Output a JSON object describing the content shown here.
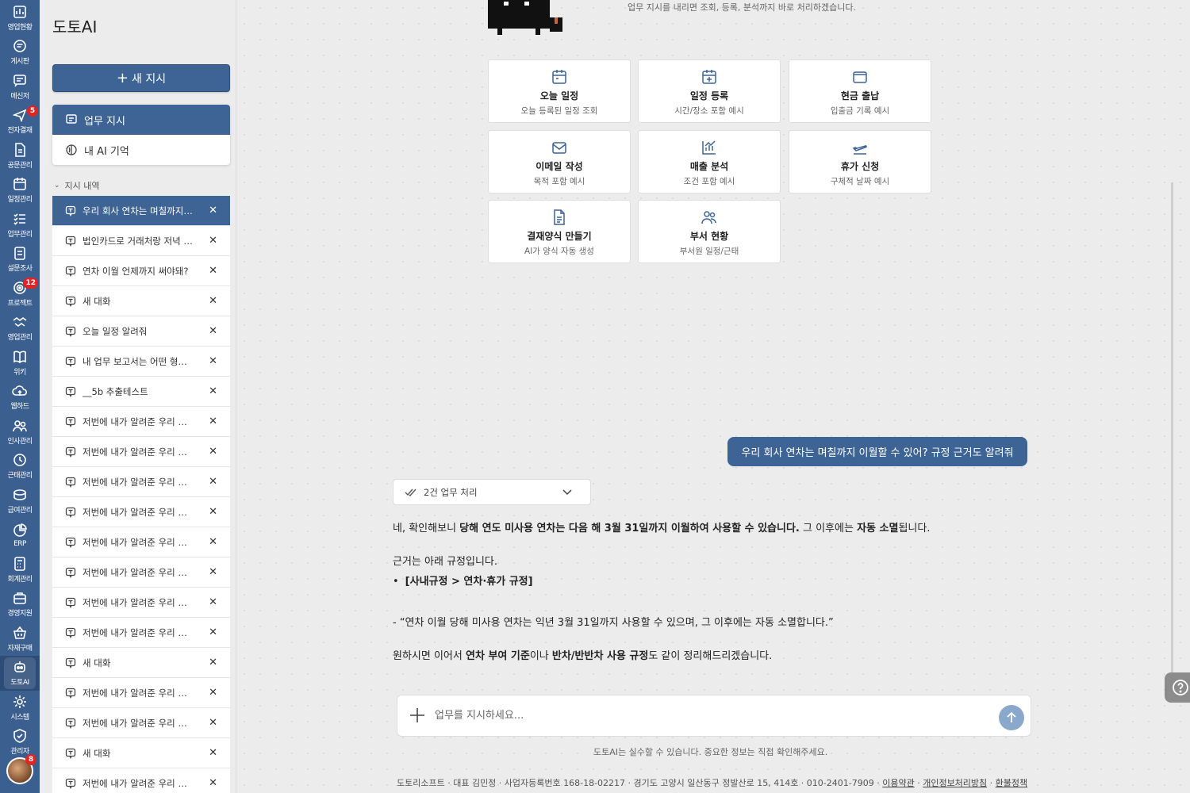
{
  "rail": {
    "items": [
      {
        "label": "영업현황",
        "icon": "dashboard-icon"
      },
      {
        "label": "게시판",
        "icon": "board-icon"
      },
      {
        "label": "메신저",
        "icon": "messenger-icon"
      },
      {
        "label": "전자결재",
        "icon": "approval-icon",
        "badge": "5"
      },
      {
        "label": "공문관리",
        "icon": "document-icon"
      },
      {
        "label": "일정관리",
        "icon": "calendar-icon"
      },
      {
        "label": "업무관리",
        "icon": "tasks-icon"
      },
      {
        "label": "설문조사",
        "icon": "survey-icon"
      },
      {
        "label": "프로젝트",
        "icon": "target-icon",
        "badge": "12"
      },
      {
        "label": "영업관리",
        "icon": "handshake-icon"
      },
      {
        "label": "위키",
        "icon": "book-icon"
      },
      {
        "label": "웹하드",
        "icon": "cloud-icon"
      },
      {
        "label": "인사관리",
        "icon": "people-icon"
      },
      {
        "label": "근태관리",
        "icon": "clock-icon"
      },
      {
        "label": "급여관리",
        "icon": "coins-icon"
      },
      {
        "label": "ERP",
        "icon": "pie-chart-icon"
      },
      {
        "label": "회계관리",
        "icon": "calculator-icon"
      },
      {
        "label": "경영지원",
        "icon": "briefcase-icon"
      },
      {
        "label": "자재구매",
        "icon": "basket-icon"
      },
      {
        "label": "도토AI",
        "icon": "robot-icon"
      },
      {
        "label": "시스템",
        "icon": "gear-icon"
      },
      {
        "label": "관리자",
        "icon": "shield-icon"
      }
    ],
    "avatar_badge": "8"
  },
  "sidebar": {
    "brand": "도토AI",
    "new_button": "새 지시",
    "modes": [
      {
        "label": "업무 지시",
        "active": true
      },
      {
        "label": "내 AI 기억",
        "active": false
      }
    ],
    "history_heading": "지시 내역",
    "history": [
      "우리 회사 연차는 며칠까지 이월할 수 있어? 규정 근거도 알려줘",
      "법인카드로 거래처랑 저녁 먹은 거 등록해줘",
      "연차 이월 언제까지 써야돼?",
      "새 대화",
      "오늘 일정 알려줘",
      "내 업무 보고서는 어떤 형식으로 쓰면 돼?",
      "__5b 추출테스트",
      "저번에 내가 알려준 우리 신입사원 교육 일정 기억해?",
      "저번에 내가 알려준 우리 신입사원 교육 일정 기억해?",
      "저번에 내가 알려준 우리 신입사원 교육 일정 기억해?",
      "저번에 내가 알려준 우리 신입사원 교육 일정 기억해?",
      "저번에 내가 알려준 우리 신입사원 교육 일정 기억해?",
      "저번에 내가 알려준 우리 신입사원 교육 일정 기억해?",
      "저번에 내가 알려준 우리 신입사원 교육 일정 기억해?",
      "저번에 내가 알려준 우리 신입사원 교육 일정 기억해?",
      "새 대화",
      "저번에 내가 알려준 우리 신입사원 교육 일정 기억해?",
      "저번에 내가 알려준 우리 신입사원 교육 일정 기억해?",
      "새 대화",
      "저번에 내가 알려준 우리 신입사원 교육 일정 기억해?"
    ]
  },
  "main": {
    "intro": "업무 지시를 내리면 조회, 등록, 분석까지 바로 처리하겠습니다.",
    "cards": [
      {
        "title": "오늘 일정",
        "sub": "오늘 등록된 일정 조회",
        "icon": "calendar-icon"
      },
      {
        "title": "일정 등록",
        "sub": "시간/장소 포함 예시",
        "icon": "calendar-plus-icon"
      },
      {
        "title": "현금 출납",
        "sub": "입출금 기록 예시",
        "icon": "wallet-icon"
      },
      {
        "title": "이메일 작성",
        "sub": "목적 포함 예시",
        "icon": "mail-icon"
      },
      {
        "title": "매출 분석",
        "sub": "조건 포함 예시",
        "icon": "chart-icon"
      },
      {
        "title": "휴가 신청",
        "sub": "구체적 날짜 예시",
        "icon": "plane-icon"
      },
      {
        "title": "결재양식 만들기",
        "sub": "AI가 양식 자동 생성",
        "icon": "file-icon"
      },
      {
        "title": "부서 현황",
        "sub": "부서원 일정/근태",
        "icon": "team-icon"
      }
    ],
    "user_message": "우리 회사 연차는 며칠까지 이월할 수 있어? 규정 근거도 알려줘",
    "task_summary": "2건 업무 처리",
    "answer": {
      "l1_a": "네, 확인해보니 ",
      "l1_b": "당해 연도 미사용 연차는 다음 해 3월 31일까지 이월하여 사용할 수 있습니다.",
      "l1_c": " 그 이후에는 ",
      "l1_d": "자동 소멸",
      "l1_e": "됩니다.",
      "l2": "근거는 아래 규정입니다.",
      "l3": "[사내규정 > 연차·휴가 규정]",
      "l4": "- “연차 이월 당해 미사용 연차는 익년 3월 31일까지 사용할 수 있으며, 그 이후에는 자동 소멸합니다.”",
      "l5_a": "원하시면 이어서 ",
      "l5_b": "연차 부여 기준",
      "l5_c": "이나 ",
      "l5_d": "반차/반반차 사용 규정",
      "l5_e": "도 같이 정리해드리겠습니다."
    },
    "input_placeholder": "업무를 지시하세요...",
    "disclaimer": "도토AI는 실수할 수 있습니다. 중요한 정보는 직접 확인해주세요.",
    "footer": {
      "text": "도토리소프트 · 대표 김민정 · 사업자등록번호 168-18-02217 · 경기도 고양시 일산동구 정발산로 15, 414호 · 010-2401-7909 · ",
      "link1": "이용약관",
      "sep1": " · ",
      "link2": "개인정보처리방침",
      "sep2": " · ",
      "link3": "환불정책"
    }
  },
  "colors": {
    "accent": "#3d6494",
    "rail": "#3b5f8f",
    "badge": "#e02424"
  }
}
